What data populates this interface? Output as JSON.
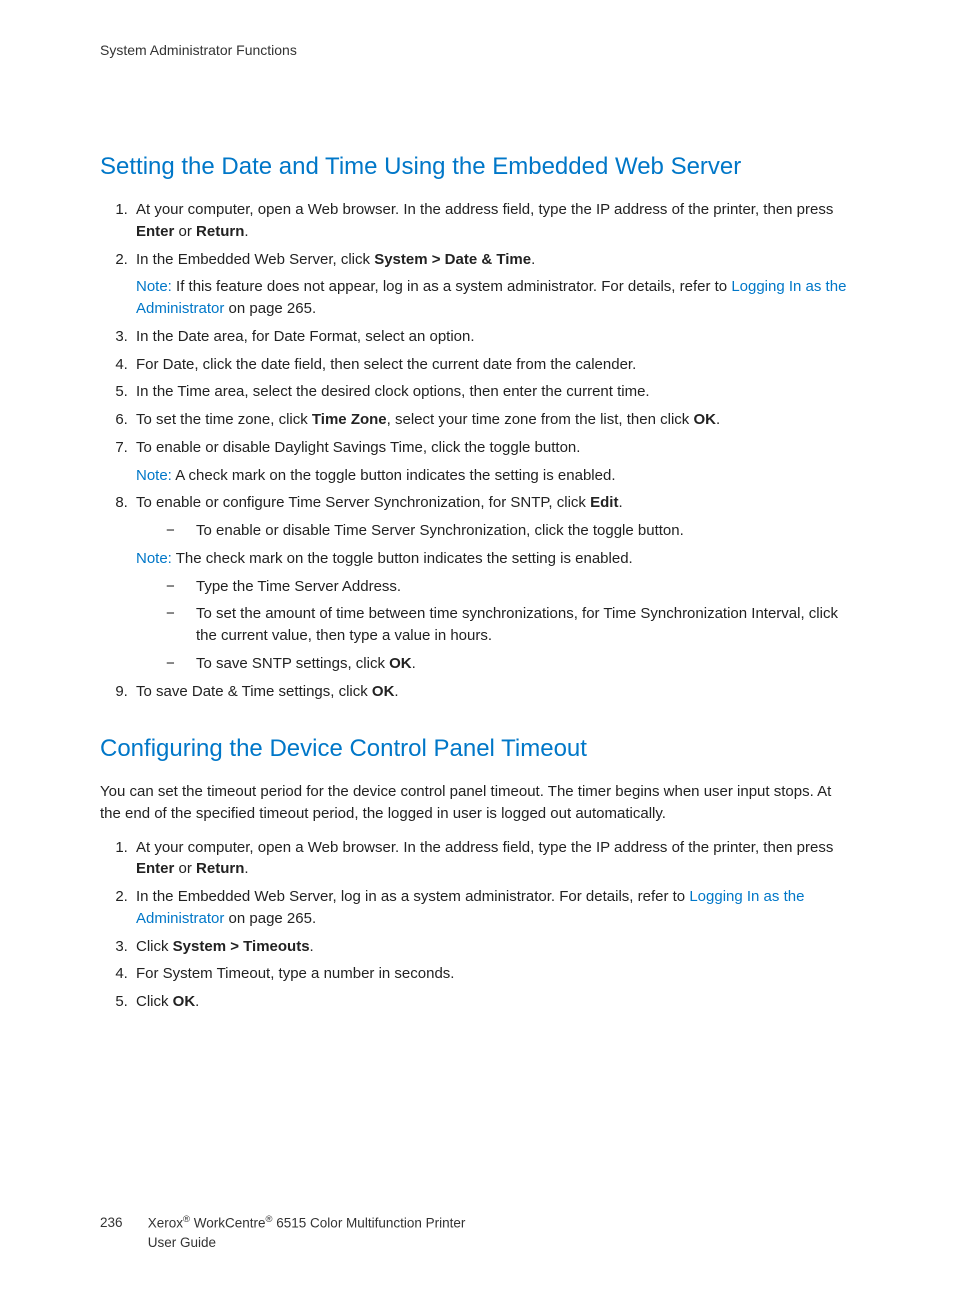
{
  "header": {
    "section_label": "System Administrator Functions"
  },
  "section1": {
    "title": "Setting the Date and Time Using the Embedded Web Server",
    "step1_a": "At your computer, open a Web browser. In the address field, type the IP address of the printer, then press ",
    "step1_b": "Enter",
    "step1_c": " or ",
    "step1_d": "Return",
    "step1_e": ".",
    "step2_a": "In the Embedded Web Server, click ",
    "step2_b": "System > Date & Time",
    "step2_c": ".",
    "note2_label": "Note:",
    "note2_a": " If this feature does not appear, log in as a system administrator. For details, refer to ",
    "note2_link": "Logging In as the Administrator",
    "note2_b": " on page 265.",
    "step3": "In the Date area, for Date Format, select an option.",
    "step4": "For Date, click the date field, then select the current date from the calender.",
    "step5": "In the Time area, select the desired clock options, then enter the current time.",
    "step6_a": "To set the time zone, click ",
    "step6_b": "Time Zone",
    "step6_c": ", select your time zone from the list, then click ",
    "step6_d": "OK",
    "step6_e": ".",
    "step7": "To enable or disable Daylight Savings Time, click the toggle button.",
    "note7_label": "Note:",
    "note7_text": " A check mark on the toggle button indicates the setting is enabled.",
    "step8_a": "To enable or configure Time Server Synchronization, for SNTP, click ",
    "step8_b": "Edit",
    "step8_c": ".",
    "step8_sub1": "To enable or disable Time Server Synchronization, click the toggle button.",
    "note8_label": "Note:",
    "note8_text": " The check mark on the toggle button indicates the setting is enabled.",
    "step8_sub2": "Type the Time Server Address.",
    "step8_sub3": "To set the amount of time between time synchronizations, for Time Synchronization Interval, click the current value, then type a value in hours.",
    "step8_sub4_a": "To save SNTP settings, click ",
    "step8_sub4_b": "OK",
    "step8_sub4_c": ".",
    "step9_a": "To save Date & Time settings, click ",
    "step9_b": "OK",
    "step9_c": "."
  },
  "section2": {
    "title": "Configuring the Device Control Panel Timeout",
    "intro": "You can set the timeout period for the device control panel timeout. The timer begins when user input stops. At the end of the specified timeout period, the logged in user is logged out automatically.",
    "step1_a": "At your computer, open a Web browser. In the address field, type the IP address of the printer, then press ",
    "step1_b": "Enter",
    "step1_c": " or ",
    "step1_d": "Return",
    "step1_e": ".",
    "step2_a": "In the Embedded Web Server, log in as a system administrator. For details, refer to ",
    "step2_link": "Logging In as the Administrator",
    "step2_b": " on page 265.",
    "step3_a": "Click ",
    "step3_b": "System > Timeouts",
    "step3_c": ".",
    "step4": "For System Timeout, type a number in seconds.",
    "step5_a": "Click ",
    "step5_b": "OK",
    "step5_c": "."
  },
  "footer": {
    "page_number": "236",
    "line1_a": "Xerox",
    "line1_b": " WorkCentre",
    "line1_c": " 6515 Color Multifunction Printer",
    "line2": "User Guide",
    "reg": "®"
  }
}
